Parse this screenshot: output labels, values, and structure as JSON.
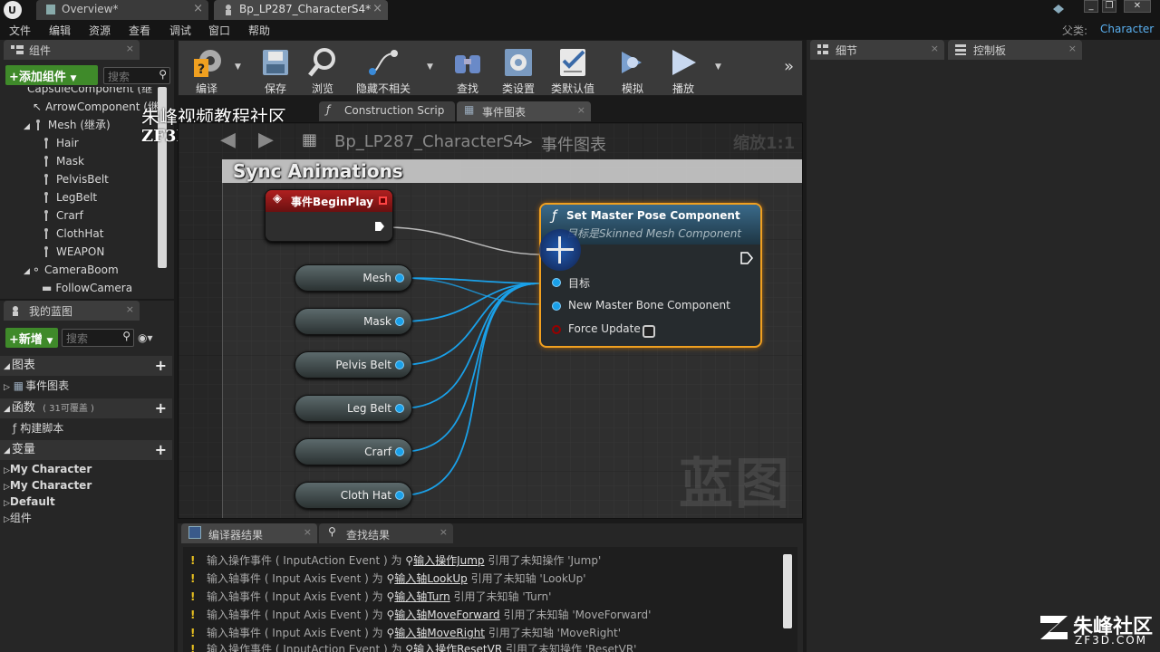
{
  "titlebar": {
    "tabs": [
      {
        "label": "Overview*"
      },
      {
        "label": "Bp_LP287_CharacterS4*"
      }
    ],
    "parent_label": "父类:",
    "parent_value": "Character"
  },
  "menu": [
    "文件",
    "编辑",
    "资源",
    "查看",
    "调试",
    "窗口",
    "帮助"
  ],
  "components_panel": {
    "title": "组件",
    "add_button": "+添加组件",
    "search_placeholder": "搜索",
    "items": [
      {
        "label": "CapsuleComponent (继"
      },
      {
        "label": "ArrowComponent (继"
      },
      {
        "label": "Mesh (继承)"
      },
      {
        "label": "Hair"
      },
      {
        "label": "Mask"
      },
      {
        "label": "PelvisBelt"
      },
      {
        "label": "LegBelt"
      },
      {
        "label": "Crarf"
      },
      {
        "label": "ClothHat"
      },
      {
        "label": "WEAPON"
      },
      {
        "label": "CameraBoom"
      },
      {
        "label": "FollowCamera"
      }
    ]
  },
  "my_blueprint": {
    "title": "我的蓝图",
    "new_button": "+新增",
    "search_placeholder": "搜索",
    "sections": {
      "graphs": "图表",
      "event_graph": "事件图表",
      "functions": "函数",
      "functions_note": "( 31可覆盖 )",
      "construction": "构建脚本",
      "variables": "变量",
      "var_items": [
        "My Character",
        "My Character",
        "Default",
        "组件"
      ]
    }
  },
  "toolbar": {
    "items": [
      {
        "label": "编译"
      },
      {
        "label": "保存"
      },
      {
        "label": "浏览"
      },
      {
        "label": "隐藏不相关"
      },
      {
        "label": "查找"
      },
      {
        "label": "类设置"
      },
      {
        "label": "类默认值"
      },
      {
        "label": "模拟"
      },
      {
        "label": "播放"
      }
    ]
  },
  "watermark": {
    "line1": "朱峰视频教程社区",
    "line2": "ZF3D.COM",
    "corner": "朱峰社区",
    "corner_sub": "ZF3D.COM"
  },
  "graph_tabs": [
    {
      "label": "Construction Scrip"
    },
    {
      "label": "事件图表"
    }
  ],
  "breadcrumb": {
    "blueprint": "Bp_LP287_CharacterS4",
    "graph": "事件图表",
    "zoom": "缩放1:1"
  },
  "graph": {
    "comment": "Sync Animations",
    "event_node": "事件BeginPlay",
    "function_node": {
      "title": "Set Master Pose Component",
      "subtitle": "目标是Skinned Mesh Component",
      "pins": [
        "目标",
        "New Master Bone Component",
        "Force Update"
      ]
    },
    "variables": [
      "Mesh",
      "Mask",
      "Pelvis Belt",
      "Leg Belt",
      "Crarf",
      "Cloth Hat"
    ],
    "watermark": "蓝图"
  },
  "details_tabs": [
    {
      "label": "细节"
    },
    {
      "label": "控制板"
    }
  ],
  "bottom_tabs": [
    {
      "label": "编译器结果"
    },
    {
      "label": "查找结果"
    }
  ],
  "log": [
    {
      "prefix": "输入操作事件 ( InputAction Event ) 为",
      "link": "输入操作Jump",
      "suffix": "引用了未知操作 'Jump'"
    },
    {
      "prefix": "输入轴事件 ( Input Axis Event ) 为",
      "link": "输入轴LookUp",
      "suffix": "引用了未知轴 'LookUp'"
    },
    {
      "prefix": "输入轴事件 ( Input Axis Event ) 为",
      "link": "输入轴Turn",
      "suffix": "引用了未知轴 'Turn'"
    },
    {
      "prefix": "输入轴事件 ( Input Axis Event ) 为",
      "link": "输入轴MoveForward",
      "suffix": "引用了未知轴 'MoveForward'"
    },
    {
      "prefix": "输入轴事件 ( Input Axis Event ) 为",
      "link": "输入轴MoveRight",
      "suffix": "引用了未知轴 'MoveRight'"
    },
    {
      "prefix": "输入操作事件 ( InputAction Event ) 为",
      "link": "输入操作ResetVR",
      "suffix": "引用了未知操作 'ResetVR'"
    }
  ]
}
